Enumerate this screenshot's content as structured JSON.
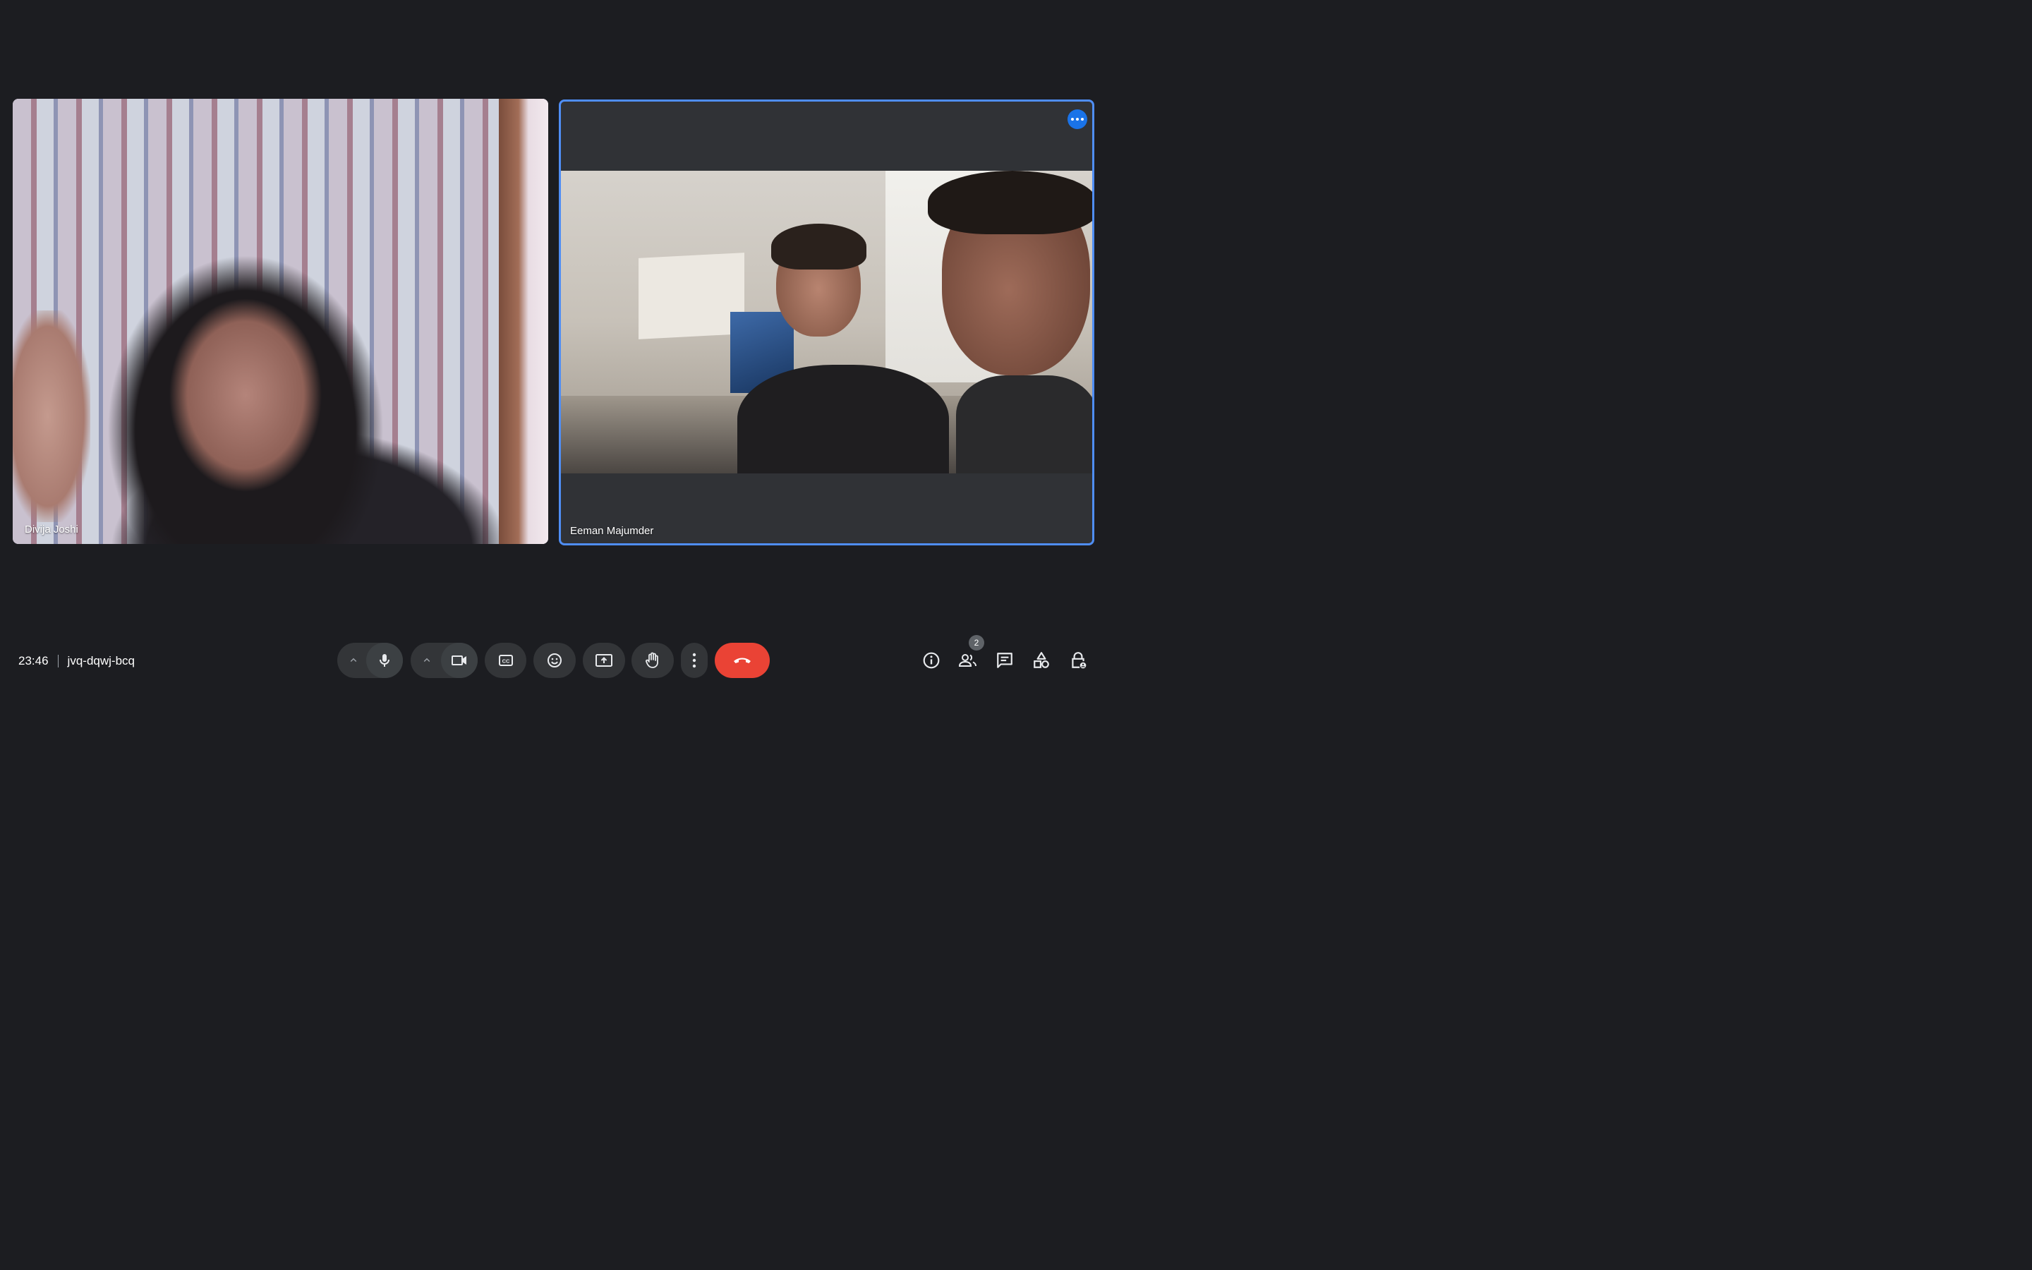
{
  "participants": [
    {
      "name": "Divija Joshi"
    },
    {
      "name": "Eeman Majumder"
    }
  ],
  "meeting": {
    "time": "23:46",
    "code": "jvq-dqwj-bcq"
  },
  "people_count": "2",
  "icons": {
    "tile_more": "more-horizontal-icon",
    "mic_caret": "chevron-up-icon",
    "mic": "microphone-icon",
    "cam_caret": "chevron-up-icon",
    "cam": "video-camera-icon",
    "captions": "closed-captions-icon",
    "emoji": "emoji-reaction-icon",
    "present": "present-screen-icon",
    "hand": "raise-hand-icon",
    "more": "more-vertical-icon",
    "leave": "end-call-icon",
    "info": "info-icon",
    "people": "people-icon",
    "chat": "chat-icon",
    "activities": "activities-icon",
    "host": "host-controls-lock-icon"
  },
  "colors": {
    "background": "#1c1d21",
    "control": "#333538",
    "leave_call": "#ea4335",
    "active_speaker_border": "#4f8ef5",
    "accent": "#1a73e8"
  }
}
